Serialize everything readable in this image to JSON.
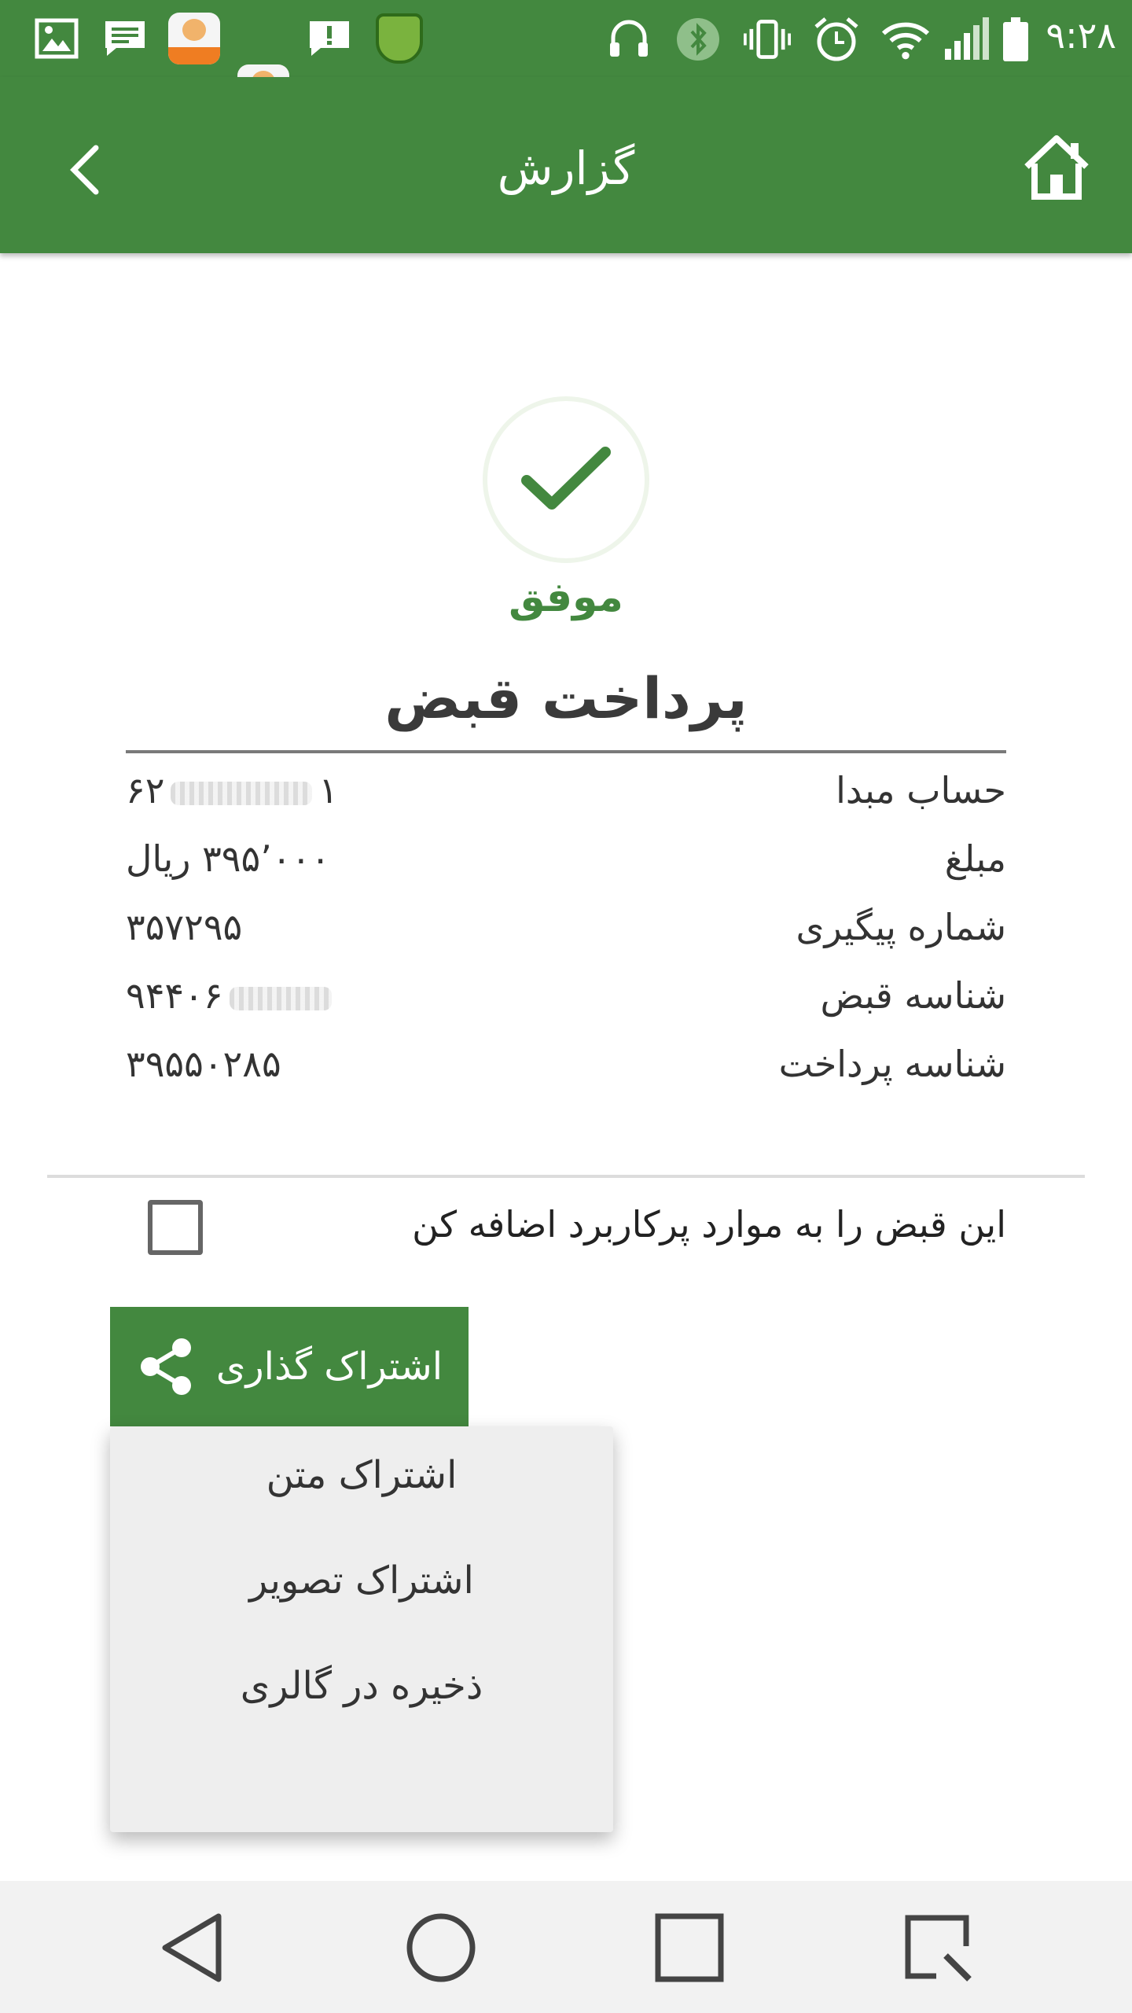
{
  "status_bar": {
    "time": "۹:۲۸",
    "left_icons": [
      "image-icon",
      "message-icon",
      "app-icon",
      "app-icon",
      "alert-message-icon",
      "shield-app-icon"
    ],
    "right_icons": [
      "headset-icon",
      "bluetooth-icon",
      "vibrate-icon",
      "alarm-icon",
      "wifi-icon",
      "signal-icon",
      "battery-icon"
    ]
  },
  "app_bar": {
    "title": "گزارش",
    "back_icon": "chevron-left-icon",
    "home_icon": "home-icon"
  },
  "status": {
    "label": "موفق",
    "icon": "checkmark-icon"
  },
  "receipt": {
    "title": "پرداخت قبض",
    "rows": [
      {
        "label": "حساب مبدا",
        "value_end": "۶۲",
        "value_start": "۱",
        "masked": true
      },
      {
        "label": "مبلغ",
        "value": "۳۹۵٬۰۰۰ ریال"
      },
      {
        "label": "شماره پیگیری",
        "value": "۳۵۷۲۹۵"
      },
      {
        "label": "شناسه قبض",
        "value": "۹۴۴۰۶",
        "masked": true
      },
      {
        "label": "شناسه پرداخت",
        "value": "۳۹۵۵۰۲۸۵"
      }
    ]
  },
  "favorite": {
    "label": "این قبض را به موارد پرکاربرد اضافه کن",
    "checked": false
  },
  "share": {
    "button_label": "اشتراک گذاری",
    "icon": "share-icon",
    "menu": [
      "اشتراک متن",
      "اشتراک تصویر",
      "ذخیره در گالری"
    ]
  },
  "nav_bar": {
    "icons": [
      "back-triangle-icon",
      "home-circle-icon",
      "recents-square-icon",
      "screenshot-icon"
    ]
  },
  "colors": {
    "primary": "#43883f",
    "popup_bg": "#eeeeee"
  }
}
